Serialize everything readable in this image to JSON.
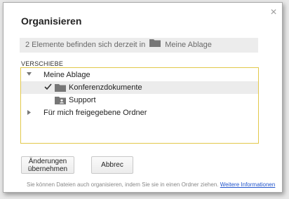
{
  "dialog": {
    "title": "Organisieren",
    "close_glyph": "×",
    "location": {
      "text": "2 Elemente befinden sich derzeit in",
      "folder_name": "Meine Ablage",
      "icon": "folder-icon"
    },
    "move_label": "VERSCHIEBE",
    "tree": [
      {
        "label": "Meine Ablage",
        "expanded": true,
        "level": 0,
        "icon": "triangle-down-icon"
      },
      {
        "label": "Konferenzdokumente",
        "level": 1,
        "selected": true,
        "checked": true,
        "icon": "folder-icon"
      },
      {
        "label": "Support",
        "level": 1,
        "icon": "shared-folder-icon"
      },
      {
        "label": "Für mich freigegebene Ordner",
        "expanded": false,
        "level": 0,
        "icon": "triangle-right-icon"
      }
    ],
    "buttons": {
      "change_line1": "Änderungen",
      "change_line2": "übernehmen",
      "cancel": "Abbrec"
    },
    "footer": {
      "text": "Sie können Dateien auch organisieren, indem Sie sie in einen Ordner ziehen.",
      "link": "Weitere Informationen"
    },
    "colors": {
      "tree_border": "#e2c84b",
      "selected_row": "#ececec",
      "link": "#2255cc"
    }
  }
}
